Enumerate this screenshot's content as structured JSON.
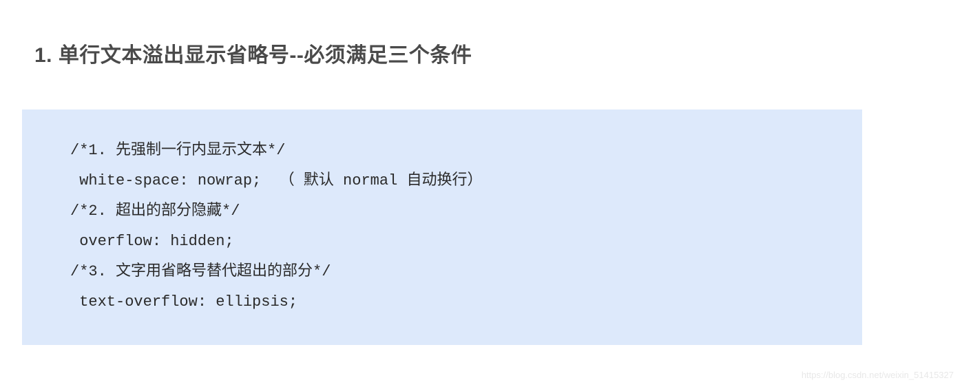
{
  "heading": "1. 单行文本溢出显示省略号--必须满足三个条件",
  "code": {
    "line1": "/*1. 先强制一行内显示文本*/",
    "line2": " white-space: nowrap;  （ 默认 normal 自动换行）",
    "line3": "/*2. 超出的部分隐藏*/",
    "line4": " overflow: hidden;",
    "line5": "/*3. 文字用省略号替代超出的部分*/",
    "line6": " text-overflow: ellipsis;"
  },
  "watermark": "https://blog.csdn.net/weixin_51415327"
}
